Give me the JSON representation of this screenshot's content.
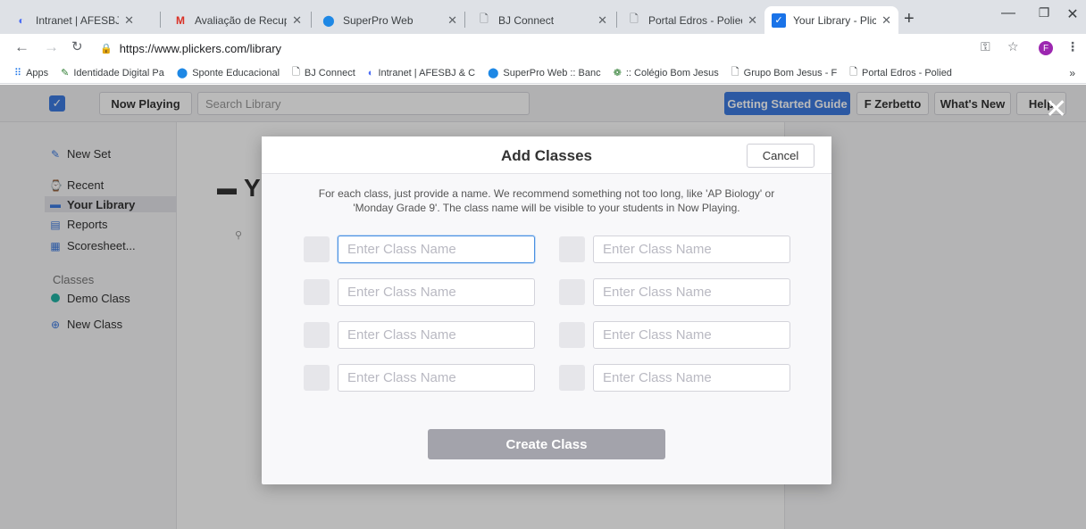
{
  "browser": {
    "tabs": [
      {
        "title": "Intranet | AFESBJ & CN",
        "icon": "globe-icon",
        "color": "#4c6ef5"
      },
      {
        "title": "Avaliação de Recuperaç",
        "icon": "gmail-icon",
        "color": "#d93025"
      },
      {
        "title": "SuperPro Web",
        "icon": "superpro-icon",
        "color": "#1e88e5"
      },
      {
        "title": "BJ Connect",
        "icon": "document-icon",
        "color": "#5f6368"
      },
      {
        "title": "Portal Edros - Poliedro",
        "icon": "document-icon",
        "color": "#5f6368"
      },
      {
        "title": "Your Library - Plickers",
        "icon": "plickers-icon",
        "color": "#1a73e8"
      }
    ],
    "url": "https://www.plickers.com/library",
    "bookmarks": [
      {
        "label": "Apps"
      },
      {
        "label": "Identidade Digital Pa"
      },
      {
        "label": "Sponte Educacional"
      },
      {
        "label": "BJ Connect"
      },
      {
        "label": "Intranet | AFESBJ & C"
      },
      {
        "label": "SuperPro Web :: Banc"
      },
      {
        "label": ":: Colégio Bom Jesus"
      },
      {
        "label": "Grupo Bom Jesus - F"
      },
      {
        "label": "Portal Edros - Polied"
      }
    ],
    "profile_initial": "F"
  },
  "app": {
    "header": {
      "now_playing": "Now Playing",
      "search_placeholder": "Search Library",
      "getting_started": "Getting Started Guide",
      "user": "F Zerbetto",
      "whats_new": "What's New",
      "help": "Help"
    },
    "sidebar": {
      "new_set": "New Set",
      "recent": "Recent",
      "your_library": "Your Library",
      "reports": "Reports",
      "scoresheet": "Scoresheet...",
      "classes_heading": "Classes",
      "demo_class": "Demo Class",
      "new_class": "New Class"
    },
    "main_title_partial": "Y"
  },
  "modal": {
    "title": "Add Classes",
    "cancel": "Cancel",
    "description": "For each class, just provide a name. We recommend something not too long, like 'AP Biology' or 'Monday Grade 9'. The class name will be visible to your students in Now Playing.",
    "input_placeholder": "Enter Class Name",
    "create_button": "Create Class"
  },
  "colors": {
    "accent": "#3d7be0",
    "demo_class": "#21b3a4",
    "disabled_button": "#a3a3ab"
  }
}
